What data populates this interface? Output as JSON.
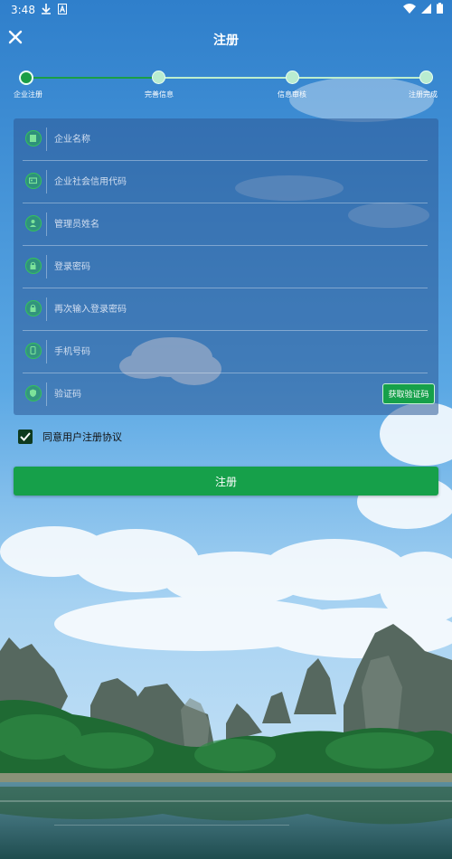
{
  "status_bar": {
    "time": "3:48",
    "left_icons": [
      "download-icon",
      "a-icon"
    ],
    "right_icons": [
      "wifi-icon",
      "signal-icon",
      "battery-icon"
    ]
  },
  "header": {
    "close_icon": "close-icon",
    "title": "注册"
  },
  "stepper": {
    "active_index": 0,
    "steps": [
      {
        "label": "企业注册"
      },
      {
        "label": "完善信息"
      },
      {
        "label": "信息审核"
      },
      {
        "label": "注册完成"
      }
    ]
  },
  "form": {
    "fields": [
      {
        "name": "company-name",
        "icon": "building-icon",
        "placeholder": "企业名称"
      },
      {
        "name": "credit-code",
        "icon": "id-card-icon",
        "placeholder": "企业社会信用代码"
      },
      {
        "name": "admin-name",
        "icon": "user-icon",
        "placeholder": "管理员姓名"
      },
      {
        "name": "password",
        "icon": "lock-icon",
        "placeholder": "登录密码"
      },
      {
        "name": "confirm-password",
        "icon": "lock-icon",
        "placeholder": "再次输入登录密码"
      },
      {
        "name": "phone",
        "icon": "phone-icon",
        "placeholder": "手机号码"
      },
      {
        "name": "verify-code",
        "icon": "shield-icon",
        "placeholder": "验证码"
      }
    ],
    "get_code_label": "获取验证码"
  },
  "agreement": {
    "checked": true,
    "label": "同意用户注册协议"
  },
  "register_label": "注册",
  "colors": {
    "accent": "#16a04a",
    "sky_top": "#3a86cf",
    "sky_mid": "#6fb4e8",
    "water": "#2d6a79"
  }
}
